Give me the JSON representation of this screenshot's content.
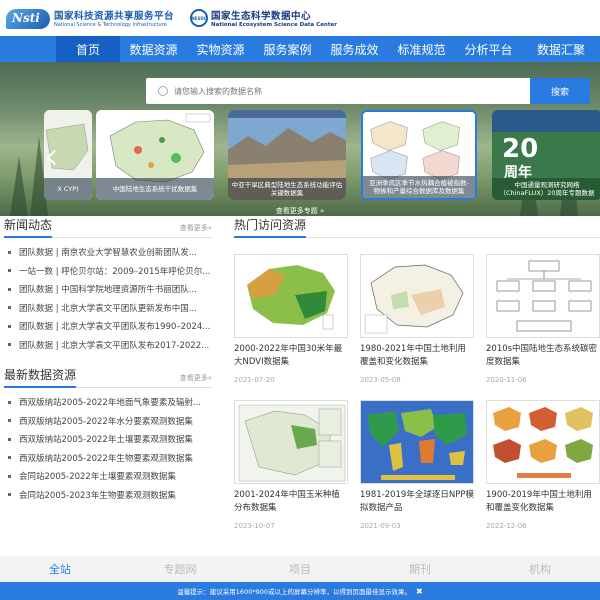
{
  "header": {
    "logo1_mark": "Nsti",
    "logo1_cn": "国家科技资源共享服务平台",
    "logo1_en": "National Science & Technology Infrastructure",
    "logo2_mark": "NESDC",
    "logo2_cn": "国家生态科学数据中心",
    "logo2_en": "National Ecosystem Science Data Center"
  },
  "nav": {
    "items": [
      "首页",
      "数据资源",
      "实物资源",
      "服务案例",
      "服务成效",
      "标准规范",
      "分析平台",
      "数据汇聚"
    ],
    "active_index": 0
  },
  "search": {
    "placeholder": "请您输入搜索的数据名称",
    "button_label": "搜索"
  },
  "banner": {
    "cards": [
      "X CYP)",
      "中国陆地生态系统干扰数据集",
      "中亚干旱区典型陆地生态系统功能评估关键数据集",
      "亚洲季风区季节水热耦合植被指数-物候和产量综合数据库及数据集",
      "中国通量观测研究网络（ChinaFLUX）20周年专题数据"
    ],
    "card5_big": "20",
    "card5_big2": "周年",
    "more_label": "查看更多专题 »"
  },
  "news": {
    "title": "新闻动态",
    "more": "查看更多»",
    "items": [
      "团队数据 | 南京农业大学智慧农业创新团队发...",
      "一站一数 | 呼伦贝尔站：2009–2015年呼伦贝尔...",
      "团队数据 | 中国科学院地理资源所牛书丽团队...",
      "团队数据 | 北京大学袁文平团队更新发布中国...",
      "团队数据 | 北京大学袁文平团队发布1990–2024...",
      "团队数据 | 北京大学袁文平团队发布2017-2022..."
    ]
  },
  "latest": {
    "title": "最新数据资源",
    "more": "查看更多»",
    "items": [
      "西双版纳站2005-2022年地面气象要素及辐射...",
      "西双版纳站2005-2022年水分要素观测数据集",
      "西双版纳站2005-2022年土壤要素观测数据集",
      "西双版纳站2005-2022年生物要素观测数据集",
      "会同站2005-2022年土壤要素观测数据集",
      "会同站2005-2023年生物要素观测数据集"
    ]
  },
  "hot": {
    "title": "热门访问资源",
    "cards": [
      {
        "title": "2000-2022年中国30米年最大NDVI数据集",
        "date": "2021-07-20"
      },
      {
        "title": "1980-2021年中国土地利用覆盖和变化数据集",
        "date": "2023-05-08"
      },
      {
        "title": "2010s中国陆地生态系统碳密度数据集",
        "date": "2020-11-06"
      },
      {
        "title": "2001-2024年中国玉米种植分布数据集",
        "date": "2023-10-07"
      },
      {
        "title": "1981-2019年全球逐日NPP模拟数据产品",
        "date": "2021-09-03"
      },
      {
        "title": "1900-2019年中国土地利用和覆盖变化数据集",
        "date": "2022-12-06"
      }
    ]
  },
  "bottom_tabs": {
    "items": [
      "全站",
      "专题网",
      "项目",
      "期刊",
      "机构"
    ],
    "active_index": 0
  },
  "notice": {
    "text": "温馨提示：建议采用1600*900或以上的屏幕分辨率，以得到页面最佳显示效果。"
  },
  "colors": {
    "primary": "#2a7be0",
    "nav_active": "#1660c4",
    "brand_dark": "#1a3a80"
  }
}
